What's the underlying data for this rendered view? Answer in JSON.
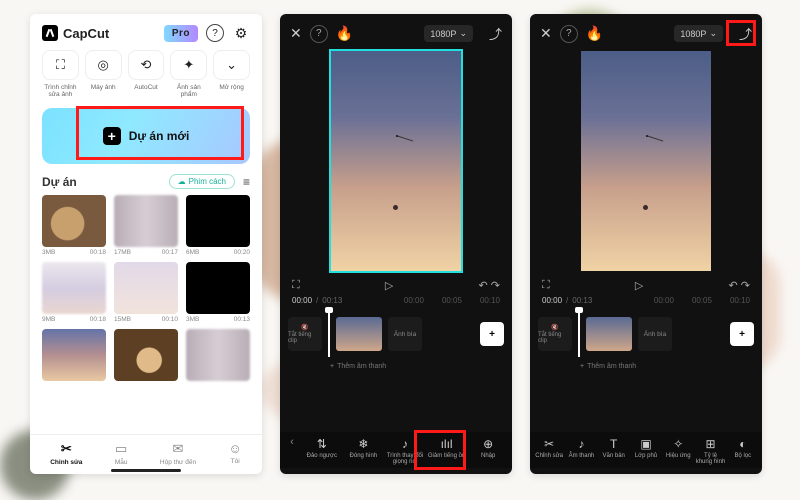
{
  "app": {
    "name": "CapCut",
    "pro_badge": "Pro"
  },
  "screen1": {
    "tools": [
      "⛶",
      "◎",
      "⟲",
      "✦",
      "⌄"
    ],
    "tool_labels": [
      "Trình chỉnh sửa ảnh",
      "Máy ảnh",
      "AutoCut",
      "Ảnh sản phẩm",
      "Mở rộng"
    ],
    "hero_label": "Dự án mới",
    "projects_title": "Dự án",
    "cloud_btn": "Phim cách",
    "thumbs": [
      {
        "size": "3MB",
        "time": "00:18"
      },
      {
        "size": "17MB",
        "time": "00:17"
      },
      {
        "size": "6MB",
        "time": "00:20"
      },
      {
        "size": "9MB",
        "time": "00:18"
      },
      {
        "size": "15MB",
        "time": "00:10"
      },
      {
        "size": "3MB",
        "time": "00:13"
      }
    ],
    "tabs": [
      {
        "icon": "✂",
        "label": "Chỉnh sửa"
      },
      {
        "icon": "▭",
        "label": "Mẫu"
      },
      {
        "icon": "✉",
        "label": "Hộp thư đến"
      },
      {
        "icon": "☺",
        "label": "Tôi"
      }
    ]
  },
  "editor": {
    "resolution": "1080P",
    "time_current": "00:00",
    "time_total": "00:13",
    "ruler": [
      "00:00",
      "00:05",
      "00:10"
    ],
    "mute_label": "Tắt tiếng clip",
    "cover_label": "Ảnh bìa",
    "add_audio": "Thêm âm thanh"
  },
  "screen2_tools": [
    {
      "icon": "⇅",
      "label": "Đảo ngược"
    },
    {
      "icon": "❄",
      "label": "Đóng hình"
    },
    {
      "icon": "♪",
      "label": "Trình thay đổi giọng nói"
    },
    {
      "icon": "ılıl",
      "label": "Giảm tiếng ồn"
    },
    {
      "icon": "⊕",
      "label": "Nhập"
    }
  ],
  "screen3_tools": [
    {
      "icon": "✂",
      "label": "Chỉnh sửa"
    },
    {
      "icon": "♪",
      "label": "Âm thanh"
    },
    {
      "icon": "T",
      "label": "Văn bản"
    },
    {
      "icon": "▣",
      "label": "Lớp phủ"
    },
    {
      "icon": "✧",
      "label": "Hiệu ứng"
    },
    {
      "icon": "⊞",
      "label": "Tỷ lệ khung hình"
    },
    {
      "icon": "◐",
      "label": "Bộ lọc"
    }
  ]
}
